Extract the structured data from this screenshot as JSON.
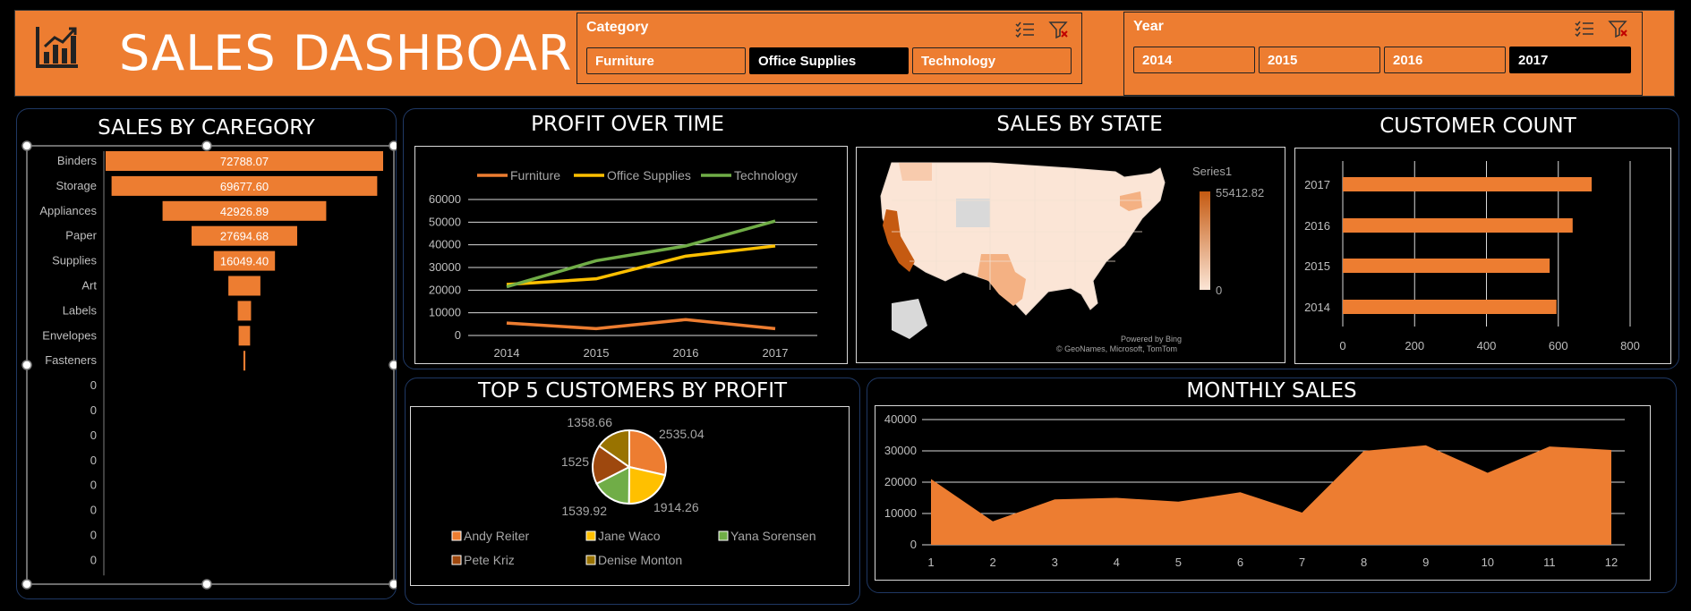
{
  "header": {
    "title": "SALES DASHBOARD",
    "icon": "bar-chart-icon"
  },
  "category_slicer": {
    "label": "Category",
    "options": [
      "Furniture",
      "Office Supplies",
      "Technology"
    ],
    "selected": "Office Supplies"
  },
  "year_slicer": {
    "label": "Year",
    "options": [
      "2014",
      "2015",
      "2016",
      "2017"
    ],
    "selected": "2017"
  },
  "colors": {
    "accent": "#ed7d31",
    "furniture": "#ed7d31",
    "office_supplies": "#ffc000",
    "technology": "#70ad47",
    "panel_border": "#1f3864"
  },
  "panels": {
    "sales_by_category": "SALES BY CAREGORY",
    "profit_over_time": "PROFIT OVER TIME",
    "sales_by_state": "SALES BY STATE",
    "customer_count": "CUSTOMER COUNT",
    "top5": "TOP 5 CUSTOMERS BY PROFIT",
    "monthly_sales": "MONTHLY SALES"
  },
  "map": {
    "legend_title": "Series1",
    "legend_max": "55412.82",
    "legend_min": "0",
    "credit1": "Powered by Bing",
    "credit2": "© GeoNames, Microsoft, TomTom"
  },
  "chart_data": [
    {
      "id": "sales_by_category",
      "type": "bar",
      "orientation": "horizontal-funnel",
      "categories": [
        "Binders",
        "Storage",
        "Appliances",
        "Paper",
        "Supplies",
        "Art",
        "Labels",
        "Envelopes",
        "Fasteners",
        "0",
        "0",
        "0",
        "0",
        "0",
        "0",
        "0",
        "0"
      ],
      "values": [
        72788.07,
        69677.6,
        42926.89,
        27694.68,
        16049.4,
        8400,
        3500,
        3000,
        500,
        0,
        0,
        0,
        0,
        0,
        0,
        0,
        0
      ],
      "value_labels": [
        "72788.07",
        "69677.60",
        "42926.89",
        "27694.68",
        "16049.40"
      ]
    },
    {
      "id": "profit_over_time",
      "type": "line",
      "x": [
        "2014",
        "2015",
        "2016",
        "2017"
      ],
      "series": [
        {
          "name": "Furniture",
          "values": [
            5500,
            3000,
            7000,
            3000
          ]
        },
        {
          "name": "Office Supplies",
          "values": [
            22500,
            25000,
            35000,
            39500
          ]
        },
        {
          "name": "Technology",
          "values": [
            21500,
            33000,
            39500,
            50500
          ]
        }
      ],
      "yticks": [
        "0",
        "10000",
        "20000",
        "30000",
        "40000",
        "50000",
        "60000"
      ],
      "ylim": [
        0,
        60000
      ]
    },
    {
      "id": "customer_count",
      "type": "bar",
      "orientation": "horizontal",
      "categories": [
        "2017",
        "2016",
        "2015",
        "2014"
      ],
      "values": [
        693,
        640,
        576,
        595
      ],
      "xticks": [
        "0",
        "200",
        "400",
        "600",
        "800"
      ],
      "xlim": [
        0,
        800
      ]
    },
    {
      "id": "top5_customers",
      "type": "pie",
      "labels": [
        "Andy Reiter",
        "Jane Waco",
        "Yana Sorensen",
        "Pete Kriz",
        "Denise Monton"
      ],
      "values": [
        2535.04,
        1914.26,
        1539.92,
        1525,
        1358.66
      ],
      "value_labels": [
        "2535.04",
        "1914.26",
        "1539.92",
        "1525",
        "1358.66"
      ],
      "colors": [
        "#ed7d31",
        "#ffc000",
        "#70ad47",
        "#9e480e",
        "#997300"
      ]
    },
    {
      "id": "monthly_sales",
      "type": "area",
      "x": [
        "1",
        "2",
        "3",
        "4",
        "5",
        "6",
        "7",
        "8",
        "9",
        "10",
        "11",
        "12"
      ],
      "values": [
        21000,
        7500,
        14500,
        15000,
        13800,
        16800,
        10300,
        30000,
        31800,
        23000,
        31400,
        30300
      ],
      "yticks": [
        "0",
        "10000",
        "20000",
        "30000",
        "40000"
      ],
      "ylim": [
        0,
        40000
      ]
    }
  ]
}
